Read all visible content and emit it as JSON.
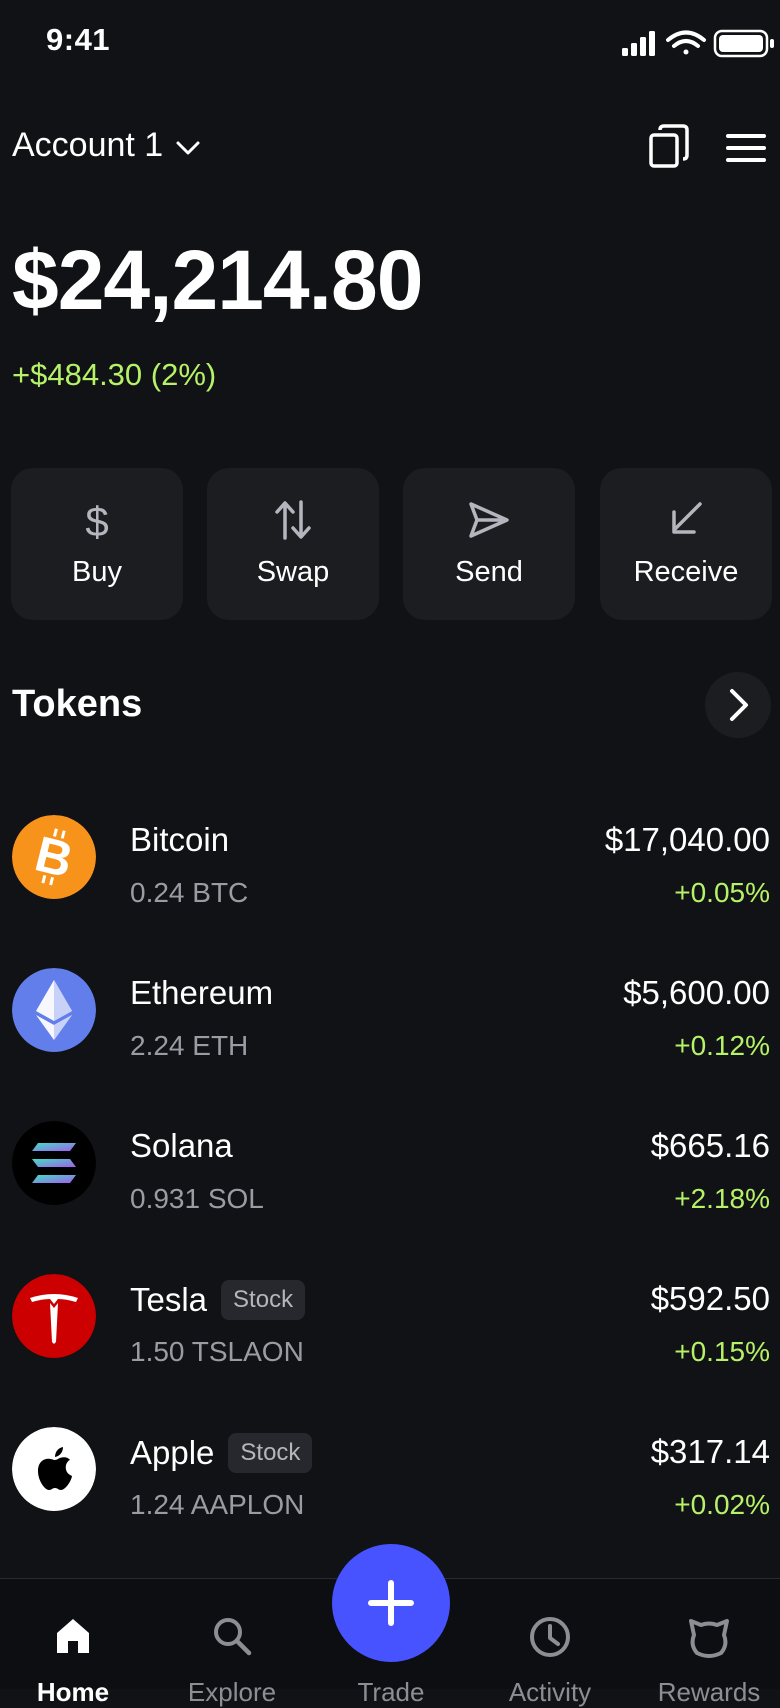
{
  "status_bar": {
    "time": "9:41",
    "icons": [
      "cellular-signal-icon",
      "wifi-icon",
      "battery-icon"
    ]
  },
  "header": {
    "account_name": "Account 1",
    "icons": [
      "chevron-down-icon",
      "copy-icon",
      "menu-icon"
    ]
  },
  "balance": {
    "total": "$24,214.80",
    "change": "+$484.30 (2%)"
  },
  "actions": [
    {
      "label": "Buy",
      "icon": "dollar-icon"
    },
    {
      "label": "Swap",
      "icon": "swap-arrows-icon"
    },
    {
      "label": "Send",
      "icon": "send-icon"
    },
    {
      "label": "Receive",
      "icon": "receive-arrow-icon"
    }
  ],
  "tokens": {
    "title": "Tokens",
    "items": [
      {
        "name": "Bitcoin",
        "amount": "0.24 BTC",
        "value": "$17,040.00",
        "change": "+0.05%",
        "badge": "",
        "icon": "bitcoin-icon"
      },
      {
        "name": "Ethereum",
        "amount": "2.24 ETH",
        "value": "$5,600.00",
        "change": "+0.12%",
        "badge": "",
        "icon": "ethereum-icon"
      },
      {
        "name": "Solana",
        "amount": "0.931 SOL",
        "value": "$665.16",
        "change": "+2.18%",
        "badge": "",
        "icon": "solana-icon"
      },
      {
        "name": "Tesla",
        "amount": "1.50 TSLAON",
        "value": "$592.50",
        "change": "+0.15%",
        "badge": "Stock",
        "icon": "tesla-icon"
      },
      {
        "name": "Apple",
        "amount": "1.24 AAPLON",
        "value": "$317.14",
        "change": "+0.02%",
        "badge": "Stock",
        "icon": "apple-icon"
      }
    ]
  },
  "nav": {
    "items": [
      {
        "label": "Home",
        "icon": "home-icon",
        "active": true
      },
      {
        "label": "Explore",
        "icon": "search-icon",
        "active": false
      },
      {
        "label": "Trade",
        "icon": "plus-icon",
        "active": false
      },
      {
        "label": "Activity",
        "icon": "clock-icon",
        "active": false
      },
      {
        "label": "Rewards",
        "icon": "rewards-icon",
        "active": false
      }
    ]
  },
  "colors": {
    "background": "#111215",
    "card": "#1c1d21",
    "positive": "#b6f268",
    "accent": "#4653ff",
    "bitcoin": "#f7931a",
    "ethereum": "#627eea",
    "tesla": "#cc0000"
  }
}
